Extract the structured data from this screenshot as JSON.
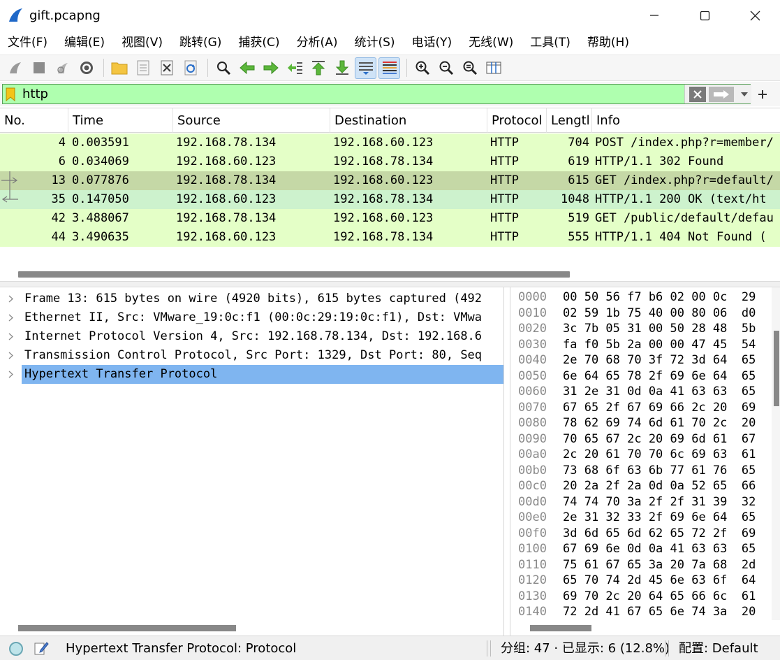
{
  "window": {
    "title": "gift.pcapng"
  },
  "menu": [
    "文件(F)",
    "编辑(E)",
    "视图(V)",
    "跳转(G)",
    "捕获(C)",
    "分析(A)",
    "统计(S)",
    "电话(Y)",
    "无线(W)",
    "工具(T)",
    "帮助(H)"
  ],
  "toolbar": {
    "buttons": [
      "start-capture",
      "stop-capture",
      "restart-capture",
      "capture-options",
      "open-file",
      "save-file",
      "close-file",
      "reload-file",
      "find-packet",
      "go-back",
      "go-forward",
      "go-to-packet",
      "go-first",
      "go-last",
      "auto-scroll",
      "colorize",
      "zoom-in",
      "zoom-out",
      "zoom-normal",
      "resize-columns"
    ]
  },
  "filter": {
    "value": "http",
    "bg_color": "#afffaf"
  },
  "packet_list": {
    "columns": [
      "No.",
      "Time",
      "Source",
      "Destination",
      "Protocol",
      "Lengtl",
      "Info"
    ],
    "rows": [
      {
        "no": "4",
        "time": "0.003591",
        "src": "192.168.78.134",
        "dst": "192.168.60.123",
        "proto": "HTTP",
        "len": "704",
        "info": "POST /index.php?r=member/",
        "bg": "#e4ffc7",
        "marker": ""
      },
      {
        "no": "6",
        "time": "0.034069",
        "src": "192.168.60.123",
        "dst": "192.168.78.134",
        "proto": "HTTP",
        "len": "619",
        "info": "HTTP/1.1 302 Found",
        "bg": "#e4ffc7",
        "marker": ""
      },
      {
        "no": "13",
        "time": "0.077876",
        "src": "192.168.78.134",
        "dst": "192.168.60.123",
        "proto": "HTTP",
        "len": "615",
        "info": "GET /index.php?r=default/",
        "bg": "#c5d8a6",
        "marker": "request"
      },
      {
        "no": "35",
        "time": "0.147050",
        "src": "192.168.60.123",
        "dst": "192.168.78.134",
        "proto": "HTTP",
        "len": "1048",
        "info": "HTTP/1.1 200 OK  (text/ht",
        "bg": "#cdf2cd",
        "marker": "response"
      },
      {
        "no": "42",
        "time": "3.488067",
        "src": "192.168.78.134",
        "dst": "192.168.60.123",
        "proto": "HTTP",
        "len": "519",
        "info": "GET /public/default/defau",
        "bg": "#e4ffc7",
        "marker": ""
      },
      {
        "no": "44",
        "time": "3.490635",
        "src": "192.168.60.123",
        "dst": "192.168.78.134",
        "proto": "HTTP",
        "len": "555",
        "info": "HTTP/1.1 404 Not Found  (",
        "bg": "#e4ffc7",
        "marker": ""
      }
    ]
  },
  "details": [
    {
      "text": "Frame 13: 615 bytes on wire (4920 bits), 615 bytes captured (492",
      "selected": false
    },
    {
      "text": "Ethernet II, Src: VMware_19:0c:f1 (00:0c:29:19:0c:f1), Dst: VMwa",
      "selected": false
    },
    {
      "text": "Internet Protocol Version 4, Src: 192.168.78.134, Dst: 192.168.6",
      "selected": false
    },
    {
      "text": "Transmission Control Protocol, Src Port: 1329, Dst Port: 80, Seq",
      "selected": false
    },
    {
      "text": "Hypertext Transfer Protocol",
      "selected": true
    }
  ],
  "bytes": [
    {
      "off": "0000",
      "hex": "00 50 56 f7 b6 02 00 0c  29"
    },
    {
      "off": "0010",
      "hex": "02 59 1b 75 40 00 80 06  d0"
    },
    {
      "off": "0020",
      "hex": "3c 7b 05 31 00 50 28 48  5b"
    },
    {
      "off": "0030",
      "hex": "fa f0 5b 2a 00 00 47 45  54"
    },
    {
      "off": "0040",
      "hex": "2e 70 68 70 3f 72 3d 64  65"
    },
    {
      "off": "0050",
      "hex": "6e 64 65 78 2f 69 6e 64  65"
    },
    {
      "off": "0060",
      "hex": "31 2e 31 0d 0a 41 63 63  65"
    },
    {
      "off": "0070",
      "hex": "67 65 2f 67 69 66 2c 20  69"
    },
    {
      "off": "0080",
      "hex": "78 62 69 74 6d 61 70 2c  20"
    },
    {
      "off": "0090",
      "hex": "70 65 67 2c 20 69 6d 61  67"
    },
    {
      "off": "00a0",
      "hex": "2c 20 61 70 70 6c 69 63  61"
    },
    {
      "off": "00b0",
      "hex": "73 68 6f 63 6b 77 61 76  65"
    },
    {
      "off": "00c0",
      "hex": "20 2a 2f 2a 0d 0a 52 65  66"
    },
    {
      "off": "00d0",
      "hex": "74 74 70 3a 2f 2f 31 39  32"
    },
    {
      "off": "00e0",
      "hex": "2e 31 32 33 2f 69 6e 64  65"
    },
    {
      "off": "00f0",
      "hex": "3d 6d 65 6d 62 65 72 2f  69"
    },
    {
      "off": "0100",
      "hex": "67 69 6e 0d 0a 41 63 63  65"
    },
    {
      "off": "0110",
      "hex": "75 61 67 65 3a 20 7a 68  2d"
    },
    {
      "off": "0120",
      "hex": "65 70 74 2d 45 6e 63 6f  64"
    },
    {
      "off": "0130",
      "hex": "69 70 2c 20 64 65 66 6c  61"
    },
    {
      "off": "0140",
      "hex": "72 2d 41 67 65 6e 74 3a  20"
    }
  ],
  "status": {
    "message": "Hypertext Transfer Protocol: Protocol",
    "packets": "分组: 47 · 已显示: 6 (12.8%)",
    "profile": "配置: Default"
  }
}
